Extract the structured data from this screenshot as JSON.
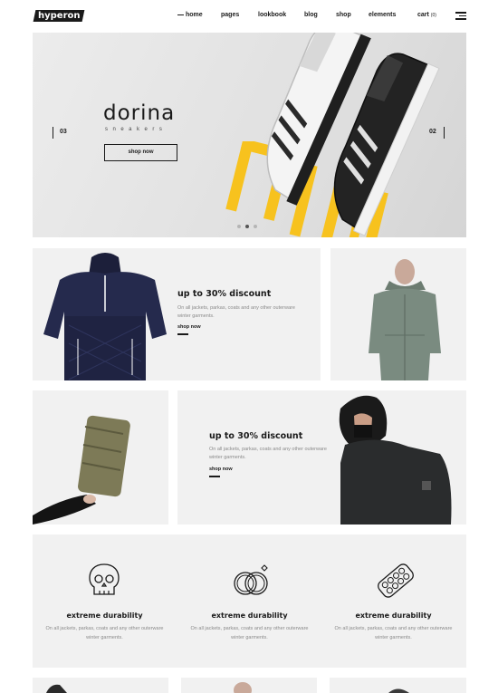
{
  "header": {
    "logo": "hyperon",
    "nav": [
      "home",
      "pages",
      "lookbook",
      "blog",
      "shop",
      "elements"
    ],
    "cart_label": "cart",
    "cart_count": "(0)"
  },
  "hero": {
    "title": "dorina",
    "subtitle": "sneakers",
    "button": "shop now",
    "slide_prev": "03",
    "slide_next": "02",
    "dots": 3,
    "active_dot": 1
  },
  "promos": [
    {
      "title": "up to 30% discount",
      "text": "On all jackets, parkas, coats and any other outerware winter garments.",
      "link": "shop now"
    },
    {
      "title": "up to 30% discount",
      "text": "On all jackets, parkas, coats and any other outerware winter garments.",
      "link": "shop now"
    }
  ],
  "features": [
    {
      "icon": "skull-icon",
      "title": "extreme durability",
      "text": "On all jackets, parkas, coats and any other outerware winter garments."
    },
    {
      "icon": "rings-icon",
      "title": "extreme durability",
      "text": "On all jackets, parkas, coats and any other outerware winter garments."
    },
    {
      "icon": "pills-icon",
      "title": "extreme durability",
      "text": "On all jackets, parkas, coats and any other outerware winter garments."
    }
  ],
  "colors": {
    "accent": "#f7c21e",
    "dark": "#1a1a1a",
    "panel": "#f1f1f1"
  }
}
